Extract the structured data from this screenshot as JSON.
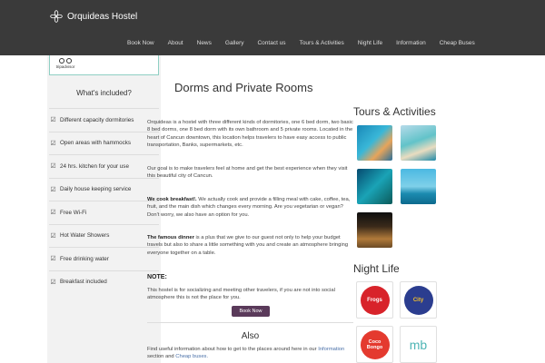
{
  "header": {
    "brand": "Orquideas Hostel",
    "nav": [
      "Book Now",
      "About",
      "News",
      "Gallery",
      "Contact us",
      "Tours & Activities",
      "Night Life",
      "Information",
      "Cheap Buses"
    ]
  },
  "sidebar": {
    "tripadvisor_text": "tripadvisor",
    "included_title": "What's included?",
    "items": [
      "Different capacity dormitories",
      "Open areas with hammocks",
      "24 hrs. kitchen for your use",
      "Daily house keeping service",
      "Free Wi-Fi",
      "Hot Water Showers",
      "Free drinking water",
      "Breakfast included"
    ]
  },
  "main": {
    "title": "Dorms and Private Rooms",
    "p1": "Orquideas is a hostel with three different kinds of dormitories, one 6 bed dorm, two basic 8 bed dorms, one 8 bed dorm with its own bathroom and 5 private rooms. Located in the heart of Cancun downtown, this location helps travelers to have easy access to public transportation, Banks, supermarkets, etc.",
    "p2": "Our goal is to make travelers feel at home and get the best experience when they visit this beautiful city of Cancun.",
    "p3_bold": "We cook breakfast!.",
    "p3_rest": " We actually cook and provide a filling meal with cake, coffee, tea, fruit, and the main dish which changes every morning. Are you vegetarian or vegan? Don't worry, we also have an option for you.",
    "p4_bold": "The famous dinner",
    "p4_rest": " is a plus that we give to our guest not only to help your budget travels but also to share a little something with you and create an atmosphere bringing everyone together on a table.",
    "note_title": "NOTE:",
    "note_text": "This hostel is for socializing and meeting other travelers, if you are not into social atmosphere this is not the place for you.",
    "book_button": "Book Now",
    "also_title": "Also",
    "also_text_1": "Find useful information about how to get to the places around here in our",
    "also_link_1": "Information",
    "also_text_2": "section and",
    "also_link_2": "Cheap buses."
  },
  "right": {
    "tours_title": "Tours & Activities",
    "night_title": "Night Life",
    "night_logos": [
      "Frogs",
      "City",
      "Coco Bongo",
      "mb"
    ]
  }
}
